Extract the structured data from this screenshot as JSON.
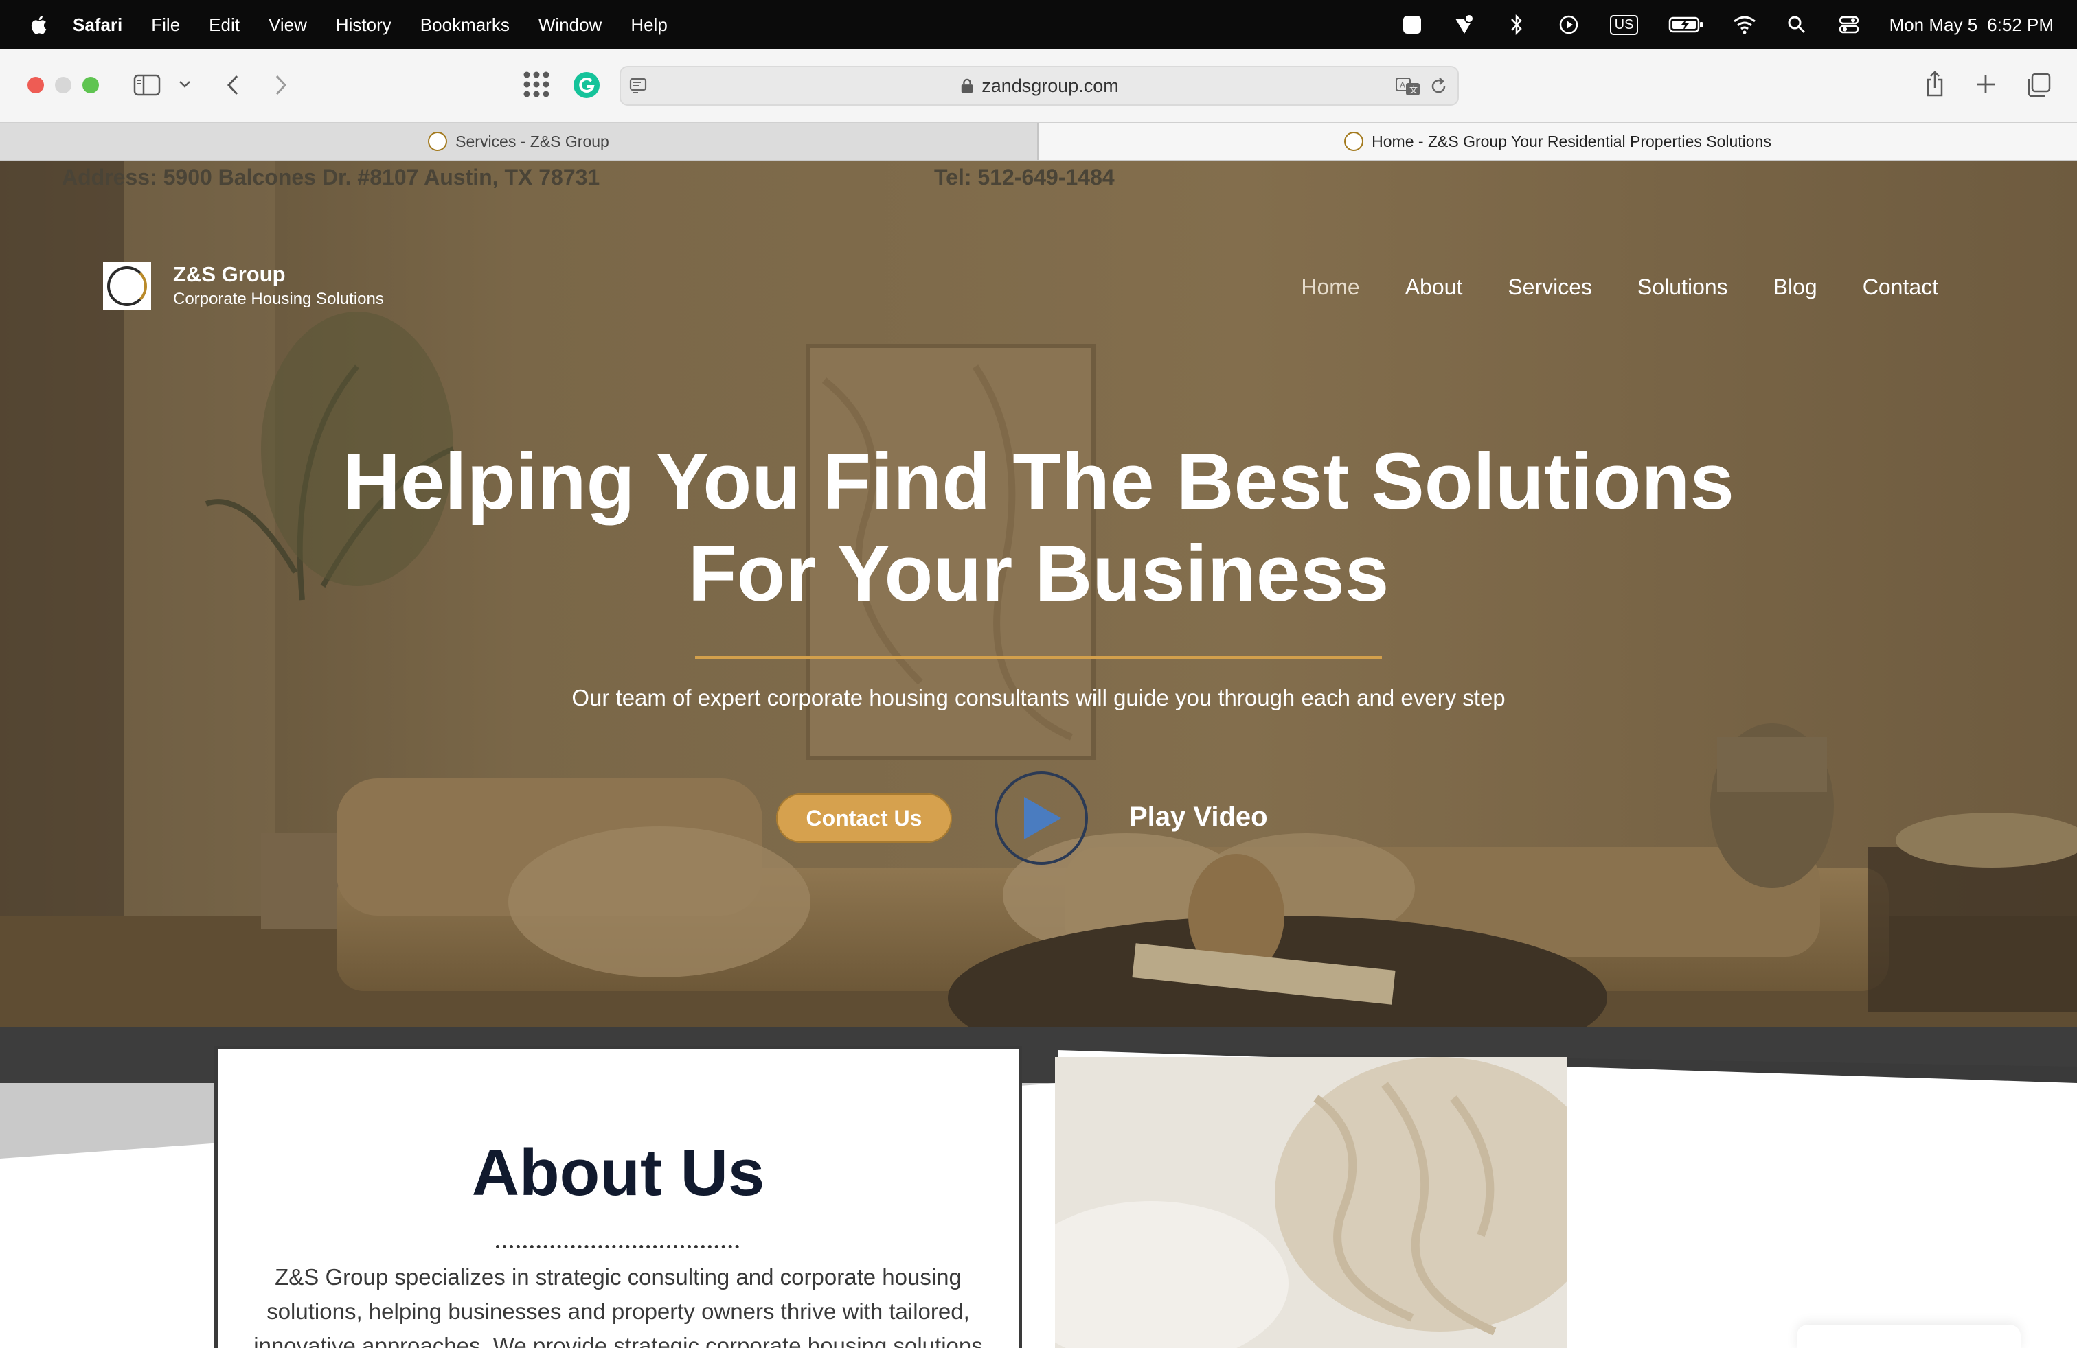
{
  "menubar": {
    "items": [
      "Safari",
      "File",
      "Edit",
      "View",
      "History",
      "Bookmarks",
      "Window",
      "Help"
    ],
    "input_source": "US",
    "date": "Mon May 5",
    "time": "6:52 PM"
  },
  "browser": {
    "url": "zandsgroup.com",
    "tabs": [
      {
        "title": "Services - Z&S Group",
        "active": false
      },
      {
        "title": "Home - Z&S Group Your Residential Properties Solutions",
        "active": true
      }
    ]
  },
  "site": {
    "topbar": {
      "address": "Address: 5900 Balcones Dr. #8107 Austin, TX 78731",
      "phone": "Tel: 512-649-1484"
    },
    "brand": {
      "name": "Z&S Group",
      "tagline": "Corporate Housing Solutions"
    },
    "nav": [
      "Home",
      "About",
      "Services",
      "Solutions",
      "Blog",
      "Contact"
    ],
    "hero": {
      "title_line1": "Helping You Find The Best Solutions",
      "title_line2": "For Your Business",
      "subtitle": "Our team of expert corporate housing consultants will guide you through each and every step",
      "cta_label": "Contact Us",
      "video_label": "Play Video"
    },
    "about": {
      "title": "About Us",
      "text": "Z&S Group specializes in strategic consulting and corporate housing solutions, helping businesses and property owners thrive with tailored, innovative approaches. We provide strategic corporate housing solutions"
    }
  },
  "colors": {
    "accent": "#d6a14e",
    "heading_dark": "#111a2e",
    "play_blue": "#4a7cc0"
  }
}
